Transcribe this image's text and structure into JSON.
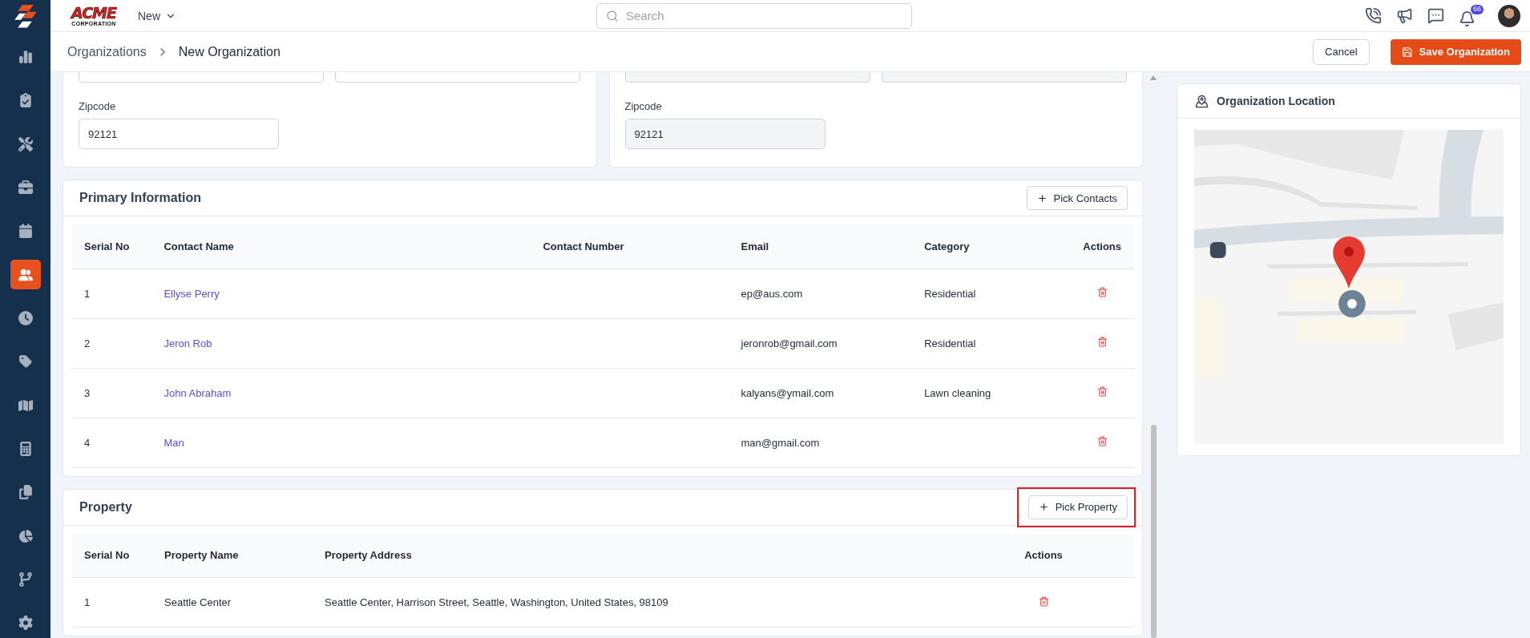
{
  "sidebar": {
    "items": [
      {
        "selected": false
      },
      {
        "selected": false
      },
      {
        "selected": false
      },
      {
        "selected": false
      },
      {
        "selected": false
      },
      {
        "selected": true
      },
      {
        "selected": false
      },
      {
        "selected": false
      },
      {
        "selected": false
      },
      {
        "selected": false
      },
      {
        "selected": false
      },
      {
        "selected": false
      },
      {
        "selected": false
      },
      {
        "selected": false
      }
    ]
  },
  "header": {
    "logo": {
      "name": "ACME",
      "subtitle": "CORPORATION"
    },
    "new_menu": {
      "label": "New"
    },
    "search": {
      "placeholder": "Search"
    },
    "notifications": {
      "badge": "66"
    }
  },
  "breadcrumb": {
    "items": [
      "Organizations",
      "New Organization"
    ]
  },
  "actions": {
    "cancel": "Cancel",
    "save": "Save Organization"
  },
  "address_forms": [
    {
      "disabled": false,
      "zipcode": {
        "label": "Zipcode",
        "value": "92121"
      }
    },
    {
      "disabled": true,
      "zipcode": {
        "label": "Zipcode",
        "value": "92121"
      }
    }
  ],
  "primary_information": {
    "title": "Primary Information",
    "pick_button": {
      "label": "Pick Contacts",
      "highlighted": false
    },
    "columns": [
      "Serial No",
      "Contact Name",
      "Contact Number",
      "Email",
      "Category",
      "Actions"
    ],
    "rows": [
      {
        "serial_no": "1",
        "contact_name": "Ellyse Perry",
        "email": "ep@aus.com",
        "category": "Residential"
      },
      {
        "serial_no": "2",
        "contact_name": "Jeron Rob",
        "email": "jeronrob@gmail.com",
        "category": "Residential"
      },
      {
        "serial_no": "3",
        "contact_name": "John Abraham",
        "email": "kalyans@ymail.com",
        "category": "Lawn cleaning"
      },
      {
        "serial_no": "4",
        "contact_name": "Man",
        "email": "man@gmail.com"
      }
    ]
  },
  "property": {
    "title": "Property",
    "pick_button": {
      "label": "Pick Property",
      "highlighted": true
    },
    "columns": [
      "Serial No",
      "Property Name",
      "Property Address",
      "Actions"
    ],
    "rows": [
      {
        "serial_no": "1",
        "property_name": "Seattle Center",
        "property_address": "Seattle Center, Harrison Street, Seattle, Washington, United States, 98109"
      }
    ]
  },
  "organization_location": {
    "title": "Organization Location"
  }
}
